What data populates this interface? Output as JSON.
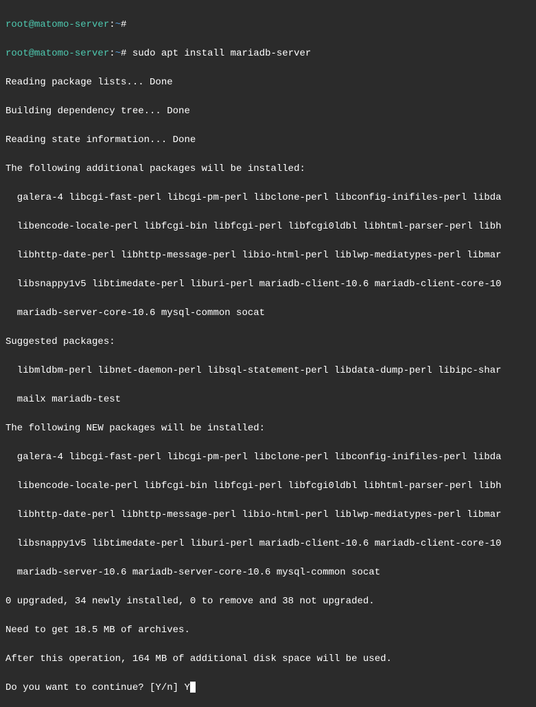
{
  "prompt1": {
    "user": "root",
    "at": "@",
    "host": "matomo-server",
    "colon": ":",
    "path": "~",
    "symbol": "#"
  },
  "prompt2": {
    "user": "root",
    "at": "@",
    "host": "matomo-server",
    "colon": ":",
    "path": "~",
    "symbol": "#",
    "command": "sudo apt install mariadb-server"
  },
  "output": {
    "line1": "Reading package lists... Done",
    "line2": "Building dependency tree... Done",
    "line3": "Reading state information... Done",
    "line4": "The following additional packages will be installed:",
    "line5": "  galera-4 libcgi-fast-perl libcgi-pm-perl libclone-perl libconfig-inifiles-perl libda",
    "line6": "  libencode-locale-perl libfcgi-bin libfcgi-perl libfcgi0ldbl libhtml-parser-perl libh",
    "line7": "  libhttp-date-perl libhttp-message-perl libio-html-perl liblwp-mediatypes-perl libmar",
    "line8": "  libsnappy1v5 libtimedate-perl liburi-perl mariadb-client-10.6 mariadb-client-core-10",
    "line9": "  mariadb-server-core-10.6 mysql-common socat",
    "line10": "Suggested packages:",
    "line11": "  libmldbm-perl libnet-daemon-perl libsql-statement-perl libdata-dump-perl libipc-shar",
    "line12": "  mailx mariadb-test",
    "line13": "The following NEW packages will be installed:",
    "line14": "  galera-4 libcgi-fast-perl libcgi-pm-perl libclone-perl libconfig-inifiles-perl libda",
    "line15": "  libencode-locale-perl libfcgi-bin libfcgi-perl libfcgi0ldbl libhtml-parser-perl libh",
    "line16": "  libhttp-date-perl libhttp-message-perl libio-html-perl liblwp-mediatypes-perl libmar",
    "line17": "  libsnappy1v5 libtimedate-perl liburi-perl mariadb-client-10.6 mariadb-client-core-10",
    "line18": "  mariadb-server-10.6 mariadb-server-core-10.6 mysql-common socat",
    "line19": "0 upgraded, 34 newly installed, 0 to remove and 38 not upgraded.",
    "line20": "Need to get 18.5 MB of archives.",
    "line21": "After this operation, 164 MB of additional disk space will be used.",
    "line22": "Do you want to continue? [Y/n] Y"
  }
}
